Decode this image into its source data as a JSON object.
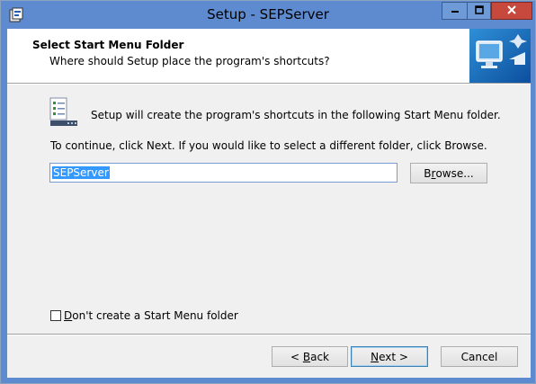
{
  "window": {
    "title": "Setup - SEPServer"
  },
  "header": {
    "title": "Select Start Menu Folder",
    "subtitle": "Where should Setup place the program's shortcuts?"
  },
  "body": {
    "info_text": "Setup will create the program's shortcuts in the following Start Menu folder.",
    "continue_text": "To continue, click Next. If you would like to select a different folder, click Browse.",
    "folder_value": "SEPServer",
    "browse_label_pre": "B",
    "browse_label_mnemonic": "r",
    "browse_label_post": "owse...",
    "checkbox_mnemonic": "D",
    "checkbox_label_post": "on't create a Start Menu folder",
    "checkbox_checked": false
  },
  "footer": {
    "back_pre": "< ",
    "back_mnemonic": "B",
    "back_post": "ack",
    "next_mnemonic": "N",
    "next_post": "ext >",
    "cancel_label": "Cancel"
  },
  "colors": {
    "titlebar": "#5e8bd0",
    "close_button": "#c7483c",
    "dialog_bg": "#f0f0f0",
    "selection": "#3399ff"
  },
  "icons": {
    "app": "setup-app-icon",
    "minimize": "minimize-icon",
    "maximize": "maximize-icon",
    "close": "close-icon",
    "header": "computer-shortcut-icon",
    "folder": "start-menu-folder-icon"
  }
}
